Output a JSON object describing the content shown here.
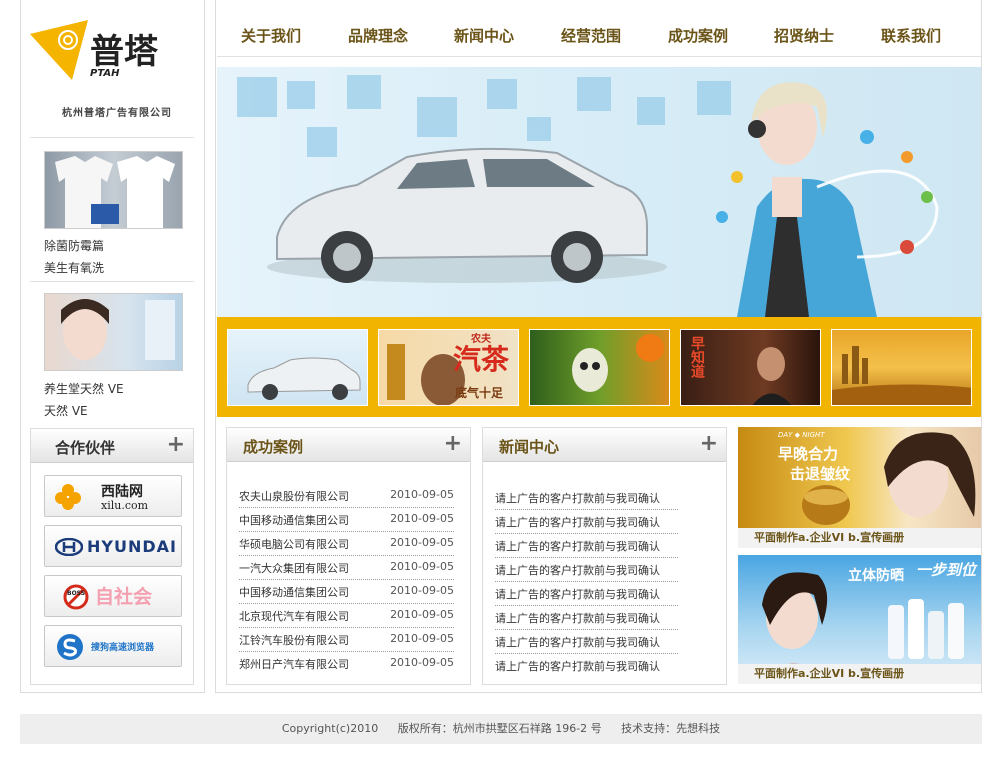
{
  "brand": {
    "logo_text": "普塔",
    "logo_sub": "PTAH",
    "company": "杭州普塔广告有限公司"
  },
  "nav": [
    {
      "label": "关于我们"
    },
    {
      "label": "品牌理念"
    },
    {
      "label": "新闻中心"
    },
    {
      "label": "经营范围"
    },
    {
      "label": "成功案例"
    },
    {
      "label": "招贤纳士"
    },
    {
      "label": "联系我们"
    }
  ],
  "sidebar": {
    "items": [
      {
        "lines": [
          "除菌防霉篇",
          "美生有氧洗"
        ]
      },
      {
        "lines": [
          "养生堂天然 VE",
          "天然 VE"
        ]
      }
    ],
    "partners": {
      "title": "合作伙伴",
      "plus": "+",
      "logos": [
        {
          "text": "西陆网",
          "sub": "xilu.com"
        },
        {
          "text": "HYUNDAI"
        },
        {
          "text": "自社会",
          "badge": "BOSS"
        },
        {
          "text": "搜狗高速浏览器"
        }
      ]
    }
  },
  "strip": {
    "thumbs": [
      {
        "overlay": ""
      },
      {
        "overlay": "汽茶",
        "sub": "底气十足",
        "top": "农夫"
      },
      {
        "overlay": ""
      },
      {
        "overlay": "早知道"
      },
      {
        "overlay": ""
      }
    ]
  },
  "cases": {
    "title": "成功案例",
    "plus": "+",
    "rows": [
      {
        "name": "农夫山泉股份有限公司",
        "date": "2010-09-05"
      },
      {
        "name": "中国移动通信集团公司",
        "date": "2010-09-05"
      },
      {
        "name": "华硕电脑公司有限公司",
        "date": "2010-09-05"
      },
      {
        "name": "一汽大众集团有限公司",
        "date": "2010-09-05"
      },
      {
        "name": "中国移动通信集团公司",
        "date": "2010-09-05"
      },
      {
        "name": "北京现代汽车有限公司",
        "date": "2010-09-05"
      },
      {
        "name": "江铃汽车股份有限公司",
        "date": "2010-09-05"
      },
      {
        "name": "郑州日产汽车有限公司",
        "date": "2010-09-05"
      }
    ]
  },
  "news": {
    "title": "新闻中心",
    "plus": "+",
    "rows": [
      "请上广告的客户打款前与我司确认",
      "请上广告的客户打款前与我司确认",
      "请上广告的客户打款前与我司确认",
      "请上广告的客户打款前与我司确认",
      "请上广告的客户打款前与我司确认",
      "请上广告的客户打款前与我司确认",
      "请上广告的客户打款前与我司确认",
      "请上广告的客户打款前与我司确认"
    ]
  },
  "ads": [
    {
      "caption": "平面制作a.企业VI  b.宣传画册",
      "headline": "早晚合力",
      "sub": "击退皱纹",
      "tag": "DAY ◆ NIGHT"
    },
    {
      "caption": "平面制作a.企业VI  b.宣传画册",
      "headline": "立体防晒",
      "sub": "一步到位"
    }
  ],
  "footer": {
    "copyright": "Copyright(c)2010",
    "rights": "版权所有：杭州市拱墅区石祥路 196-2 号",
    "support": "技术支持：先想科技"
  },
  "colors": {
    "accent": "#6b5418",
    "strip": "#f1b400",
    "logo": "#f4b400"
  }
}
